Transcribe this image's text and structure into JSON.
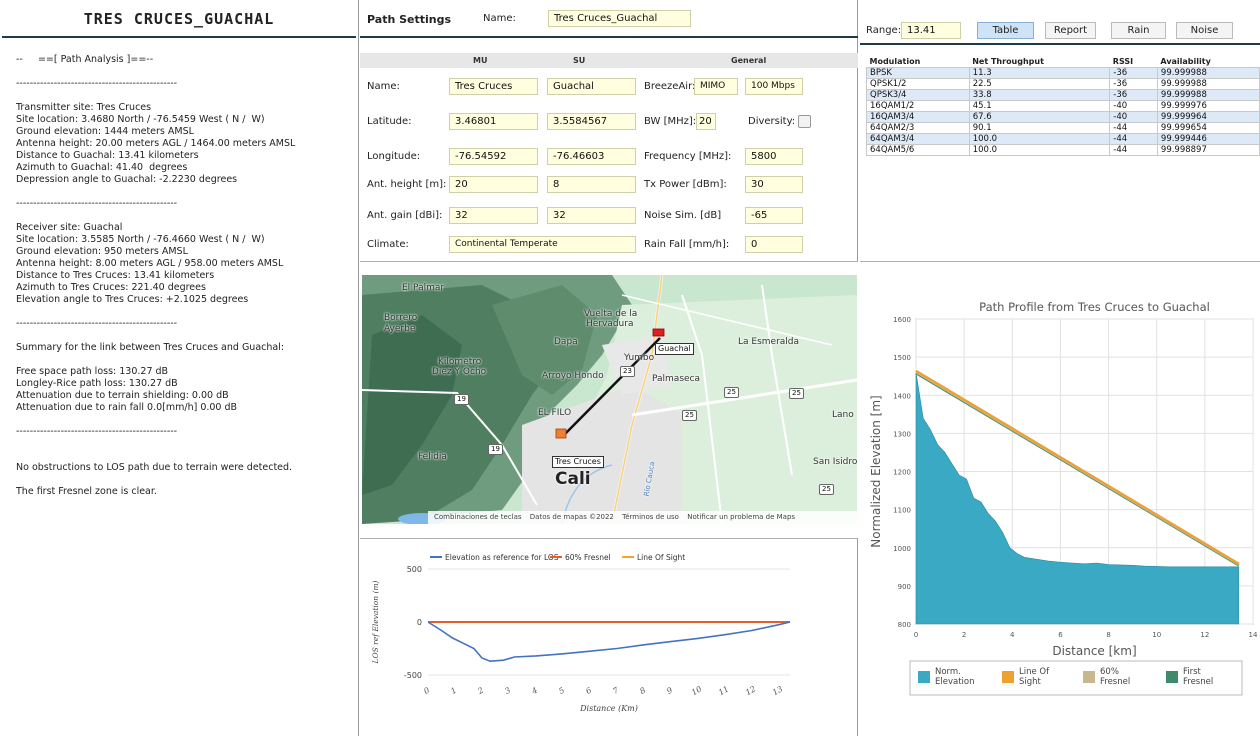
{
  "report": {
    "title": "TRES CRUCES_GUACHAL",
    "lines": [
      "--     ==[ Path Analysis ]==--",
      "",
      "-----------------------------------------------",
      "",
      "Transmitter site: Tres Cruces",
      "Site location: 3.4680 North / -76.5459 West ( N /  W)",
      "Ground elevation: 1444 meters AMSL",
      "Antenna height: 20.00 meters AGL / 1464.00 meters AMSL",
      "Distance to Guachal: 13.41 kilometers",
      "Azimuth to Guachal: 41.40  degrees",
      "Depression angle to Guachal: -2.2230 degrees",
      "",
      "-----------------------------------------------",
      "",
      "Receiver site: Guachal",
      "Site location: 3.5585 North / -76.4660 West ( N /  W)",
      "Ground elevation: 950 meters AMSL",
      "Antenna height: 8.00 meters AGL / 958.00 meters AMSL",
      "Distance to Tres Cruces: 13.41 kilometers",
      "Azimuth to Tres Cruces: 221.40 degrees",
      "Elevation angle to Tres Cruces: +2.1025 degrees",
      "",
      "-----------------------------------------------",
      "",
      "Summary for the link between Tres Cruces and Guachal:",
      "",
      "Free space path loss: 130.27 dB",
      "Longley-Rice path loss: 130.27 dB",
      "Attenuation due to terrain shielding: 0.00 dB",
      "Attenuation due to rain fall 0.0[mm/h] 0.00 dB",
      "",
      "-----------------------------------------------",
      "",
      "",
      "No obstructions to LOS path due to terrain were detected.",
      "",
      "The first Fresnel zone is clear."
    ]
  },
  "settings": {
    "title": "Path Settings",
    "name_label": "Name:",
    "name_value": "Tres Cruces_Guachal",
    "col_mu": "MU",
    "col_su": "SU",
    "col_general": "General",
    "rows": {
      "name": {
        "label": "Name:",
        "mu": "Tres Cruces",
        "su": "Guachal"
      },
      "latitude": {
        "label": "Latitude:",
        "mu": "3.46801",
        "su": "3.5584567"
      },
      "longitude": {
        "label": "Longitude:",
        "mu": "-76.54592",
        "su": "-76.46603"
      },
      "ant_height": {
        "label": "Ant. height [m]:",
        "mu": "20",
        "su": "8"
      },
      "ant_gain": {
        "label": "Ant. gain [dBi]:",
        "mu": "32",
        "su": "32"
      },
      "climate": {
        "label": "Climate:",
        "value": "Continental Temperate"
      }
    },
    "general": {
      "breezeair_label": "BreezeAir:",
      "breezeair_value": "MIMO",
      "speed_value": "100 Mbps",
      "bw_label": "BW [MHz]:",
      "bw_value": "20",
      "diversity_label": "Diversity:",
      "frequency_label": "Frequency [MHz]:",
      "frequency_value": "5800",
      "txpower_label": "Tx Power [dBm]:",
      "txpower_value": "30",
      "noise_label": "Noise Sim. [dB]",
      "noise_value": "-65",
      "rainfall_label": "Rain Fall [mm/h]:",
      "rainfall_value": "0"
    }
  },
  "map": {
    "labels": {
      "el_palmar": "El Palmar",
      "borrero": "Borrero",
      "ayerbe": "Ayerbe",
      "vuelta": "Vuelta de la",
      "hervadura": "Hervadura",
      "dapa": "Dapa",
      "yumbo": "Yumbo",
      "la_esmeralda": "La Esmeralda",
      "kilometro": "Kilometro",
      "diez_y_ocho": "Diez Y Ocho",
      "arroyo": "Arroyo Hondo",
      "palmaseca": "Palmaseca",
      "el_filo": "EL FILO",
      "lano": "Lano",
      "felidia": "Felidia",
      "san_isidro": "San Isidro",
      "cali": "Cali",
      "rio_cauca": "Río Cauca"
    },
    "markers": {
      "rx": "Guachal",
      "tx": "Tres Cruces"
    },
    "roads": {
      "r23": "23",
      "r25a": "25",
      "r25b": "25",
      "r25c": "25",
      "r25d": "25",
      "r19a": "19",
      "r19b": "19"
    },
    "footer": {
      "shortcuts": "Combinaciones de teclas",
      "data": "Datos de mapas ©2022",
      "terms": "Términos de uso",
      "report": "Notificar un problema de Maps"
    }
  },
  "toolbar": {
    "range_label": "Range:",
    "range_value": "13.41",
    "table": "Table",
    "report": "Report",
    "rain": "Rain",
    "noise": "Noise"
  },
  "table": {
    "headers": [
      "Modulation",
      "Net Throughput",
      "RSSI",
      "Availability"
    ],
    "rows": [
      [
        "BPSK",
        "11.3",
        "-36",
        "99.999988"
      ],
      [
        "QPSK1/2",
        "22.5",
        "-36",
        "99.999988"
      ],
      [
        "QPSK3/4",
        "33.8",
        "-36",
        "99.999988"
      ],
      [
        "16QAM1/2",
        "45.1",
        "-40",
        "99.999976"
      ],
      [
        "16QAM3/4",
        "67.6",
        "-40",
        "99.999964"
      ],
      [
        "64QAM2/3",
        "90.1",
        "-44",
        "99.999654"
      ],
      [
        "64QAM3/4",
        "100.0",
        "-44",
        "99.999446"
      ],
      [
        "64QAM5/6",
        "100.0",
        "-44",
        "99.998897"
      ]
    ],
    "highlight_rows": [
      0,
      2,
      4,
      6
    ]
  },
  "chart_data": [
    {
      "type": "line",
      "legend": [
        "Elevation as reference for LOS",
        "60% Fresnel",
        "Line Of Sight"
      ],
      "xlabel": "Distance (Km)",
      "ylabel": "LOS ref Elevation (m)",
      "xlim": [
        0,
        13.41
      ],
      "ylim": [
        -500,
        500
      ],
      "yticks": [
        500,
        0,
        -500
      ],
      "xticks": [
        0,
        1,
        2,
        3,
        4,
        5,
        6,
        7,
        8,
        9,
        10,
        11,
        12,
        13
      ],
      "series": [
        {
          "name": "Elevation as reference for LOS",
          "color": "#4472c4",
          "x": [
            0,
            0.5,
            0.9,
            1.3,
            1.7,
            2.0,
            2.3,
            2.8,
            3.2,
            4.0,
            5.0,
            6.0,
            7.0,
            8.0,
            9.0,
            10.0,
            11.0,
            12.0,
            13.0,
            13.41
          ],
          "y": [
            0,
            -80,
            -150,
            -200,
            -250,
            -340,
            -370,
            -360,
            -330,
            -320,
            -300,
            -275,
            -250,
            -215,
            -185,
            -155,
            -120,
            -80,
            -25,
            0
          ]
        },
        {
          "name": "60% Fresnel",
          "color": "#ed5a2a",
          "x": [
            0,
            13.41
          ],
          "y": [
            0,
            0
          ]
        },
        {
          "name": "Line Of Sight",
          "color": "#f5a623",
          "x": [
            0,
            13.41
          ],
          "y": [
            0,
            0
          ]
        }
      ]
    },
    {
      "type": "area",
      "title": "Path Profile from Tres Cruces to Guachal",
      "xlabel": "Distance [km]",
      "ylabel": "Normalized Elevation [m]",
      "xlim": [
        0,
        14
      ],
      "ylim": [
        800,
        1600
      ],
      "xticks": [
        0,
        2,
        4,
        6,
        8,
        10,
        12,
        14
      ],
      "yticks": [
        800,
        900,
        1000,
        1100,
        1200,
        1300,
        1400,
        1500,
        1600
      ],
      "legend": [
        "Norm. Elevation",
        "Line Of Sight",
        "60% Fresnel",
        "First Fresnel"
      ],
      "series": [
        {
          "name": "Norm. Elevation",
          "color": "#3aa9c3",
          "x": [
            0,
            0.3,
            0.6,
            0.9,
            1.2,
            1.5,
            1.8,
            2.1,
            2.4,
            2.7,
            3.0,
            3.3,
            3.6,
            3.9,
            4.2,
            4.5,
            5.0,
            5.5,
            6.0,
            6.5,
            7.0,
            7.5,
            8.0,
            8.5,
            9.0,
            9.5,
            10.0,
            10.5,
            11.0,
            11.5,
            12.0,
            12.5,
            13.0,
            13.41
          ],
          "y": [
            1460,
            1340,
            1310,
            1270,
            1250,
            1220,
            1190,
            1180,
            1130,
            1120,
            1090,
            1070,
            1040,
            1000,
            985,
            975,
            970,
            965,
            962,
            960,
            958,
            960,
            956,
            955,
            954,
            952,
            951,
            950,
            950,
            950,
            950,
            950,
            950,
            950
          ]
        },
        {
          "name": "Line Of Sight",
          "color": "#f0a030",
          "x": [
            0,
            13.41
          ],
          "y": [
            1464,
            958
          ]
        },
        {
          "name": "60% Fresnel",
          "color": "#c8b890",
          "x": [
            0,
            13.41
          ],
          "y": [
            1461,
            956
          ]
        },
        {
          "name": "First Fresnel",
          "color": "#3f8a6a",
          "x": [
            0,
            13.41
          ],
          "y": [
            1458,
            954
          ]
        }
      ]
    }
  ]
}
